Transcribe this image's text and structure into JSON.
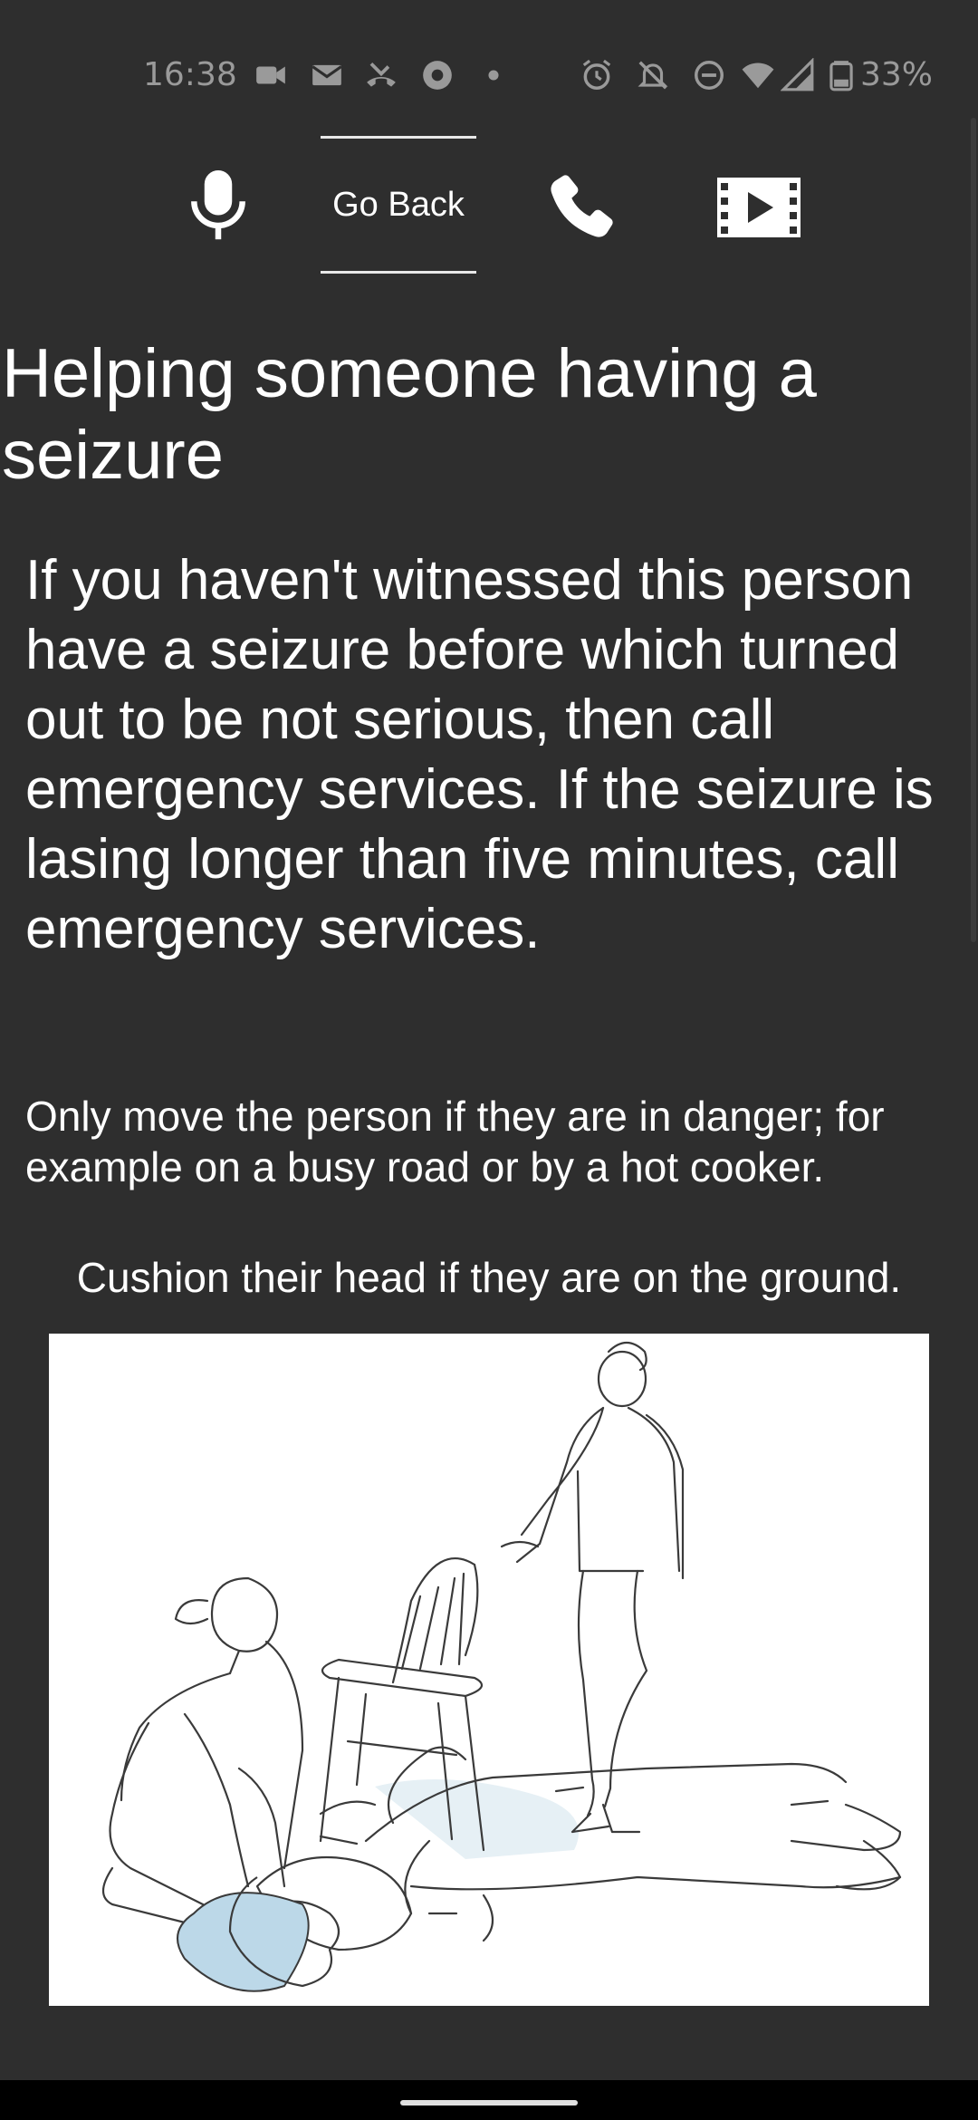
{
  "status_bar": {
    "time": "16:38",
    "battery": "33%",
    "icons": [
      "video-camera-icon",
      "mail-icon",
      "missed-call-icon",
      "media-play-icon",
      "dot-icon",
      "alarm-icon",
      "bell-off-icon",
      "do-not-disturb-icon",
      "wifi-icon",
      "cell-signal-icon",
      "battery-icon"
    ]
  },
  "toolbar": {
    "go_back_label": "Go Back",
    "icons": [
      "microphone-icon",
      "phone-icon",
      "video-icon"
    ]
  },
  "content": {
    "title": "Helping someone having a seizure",
    "intro": "If you haven't witnessed this person have a seizure before which turned out to be not serious, then call emergency services. If the seizure is lasing longer than five minutes, call emergency services.",
    "move_instruction": "Only move the person if they are in danger; for example on a busy road or by a hot cooker.",
    "cushion_instruction": "Cushion their head if they are on the ground."
  },
  "colors": {
    "background": "#2e2e2e",
    "text": "#ffffff",
    "status_text": "#9a9a9a",
    "nav_bar": "#000000",
    "pillow": "#bcd8e8"
  }
}
